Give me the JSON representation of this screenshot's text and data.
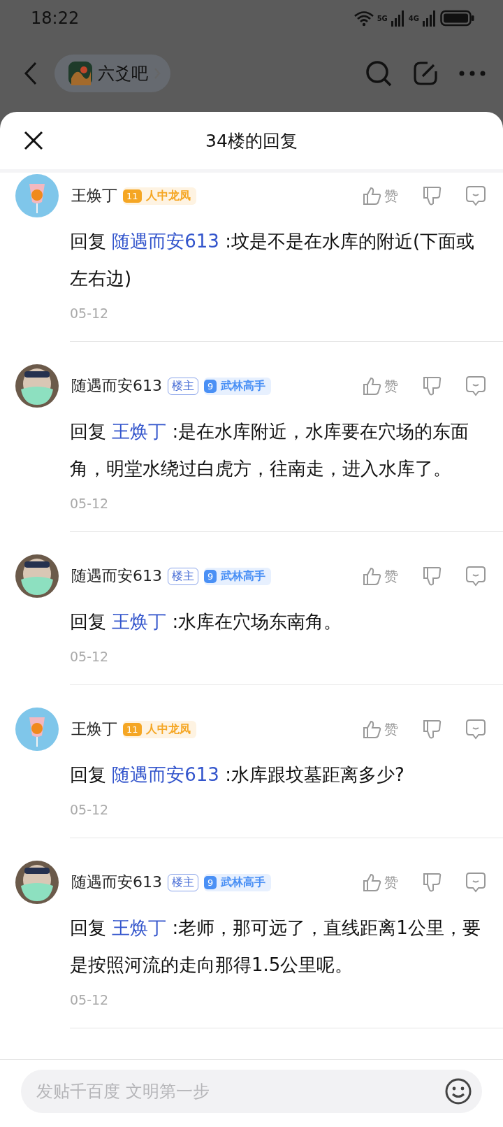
{
  "status_bar": {
    "time": "18:22",
    "network_1": "5G",
    "network_2": "4G"
  },
  "nav": {
    "forum": "六爻吧"
  },
  "sheet": {
    "title": "34楼的回复"
  },
  "comments": [
    {
      "user": "王焕丁",
      "avatar": {
        "kind": "orange"
      },
      "is_owner": false,
      "level": "11",
      "rank": "人中龙凤",
      "color": "#f5a623",
      "like_label": "赞",
      "reply_label": "回复",
      "reply_to": "随遇而安613",
      "text": ":坟是不是在水库的附近(下面或左右边)",
      "date": "05-12"
    },
    {
      "user": "随遇而安613",
      "avatar": {
        "kind": "mask"
      },
      "is_owner": true,
      "owner_label": "楼主",
      "level": "9",
      "rank": "武林高手",
      "color": "#4a90f5",
      "like_label": "赞",
      "reply_label": "回复",
      "reply_to": "王焕丁",
      "text": ":是在水库附近，水库要在穴场的东面角，明堂水绕过白虎方，往南走，进入水库了。",
      "date": "05-12"
    },
    {
      "user": "随遇而安613",
      "avatar": {
        "kind": "mask"
      },
      "is_owner": true,
      "owner_label": "楼主",
      "level": "9",
      "rank": "武林高手",
      "color": "#4a90f5",
      "like_label": "赞",
      "reply_label": "回复",
      "reply_to": "王焕丁",
      "text": ":水库在穴场东南角。",
      "date": "05-12"
    },
    {
      "user": "王焕丁",
      "avatar": {
        "kind": "orange"
      },
      "is_owner": false,
      "level": "11",
      "rank": "人中龙凤",
      "color": "#f5a623",
      "like_label": "赞",
      "reply_label": "回复",
      "reply_to": "随遇而安613",
      "text": ":水库跟坟墓距离多少?",
      "date": "05-12"
    },
    {
      "user": "随遇而安613",
      "avatar": {
        "kind": "mask"
      },
      "is_owner": true,
      "owner_label": "楼主",
      "level": "9",
      "rank": "武林高手",
      "color": "#4a90f5",
      "like_label": "赞",
      "reply_label": "回复",
      "reply_to": "王焕丁",
      "text": ":老师，那可远了，直线距离1公里，要是按照河流的走向那得1.5公里呢。",
      "date": "05-12"
    }
  ],
  "composer": {
    "placeholder": "发贴千百度 文明第一步"
  }
}
